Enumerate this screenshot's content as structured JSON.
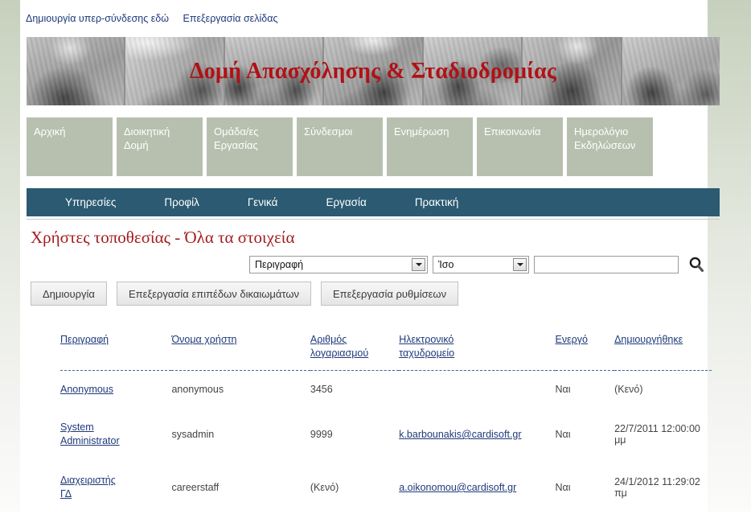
{
  "colors": {
    "brand_red": "#b01116",
    "title_red": "#a41c20",
    "sage": "#b7c0ae",
    "teal": "#2b5a72",
    "link_blue": "#1f3a7a"
  },
  "topbar": {
    "links": [
      {
        "label": "Δημιουργία υπερ-σύνδεσης εδώ"
      },
      {
        "label": "Επεξεργασία σελίδας"
      }
    ]
  },
  "banner": {
    "title": "Δομή Απασχόλησης & Σταδιοδρομίας"
  },
  "mainnav": {
    "items": [
      {
        "line1": "Αρχική",
        "line2": ""
      },
      {
        "line1": "Διοικητική",
        "line2": "Δομή"
      },
      {
        "line1": "Ομάδα/ες",
        "line2": "Εργασίας"
      },
      {
        "line1": "Σύνδεσμοι",
        "line2": ""
      },
      {
        "line1": "Ενημέρωση",
        "line2": ""
      },
      {
        "line1": "Επικοινωνία",
        "line2": ""
      },
      {
        "line1": "Ημερολόγιο",
        "line2": "Εκδηλώσεων"
      }
    ]
  },
  "subnav": {
    "items": [
      {
        "label": "Υπηρεσίες"
      },
      {
        "label": "Προφίλ"
      },
      {
        "label": "Γενικά"
      },
      {
        "label": "Εργασία"
      },
      {
        "label": "Πρακτική"
      }
    ]
  },
  "content": {
    "page_title": "Χρήστες τοποθεσίας - Όλα τα στοιχεία"
  },
  "filter": {
    "field_select": "Περιγραφή",
    "operator_select": "Ίσο",
    "search_value": "",
    "search_placeholder": "",
    "search_icon": "search-icon"
  },
  "buttons": [
    {
      "label": "Δημιουργία"
    },
    {
      "label": "Επεξεργασία επιπέδων δικαιωμάτων"
    },
    {
      "label": "Επεξεργασία ρυθμίσεων"
    }
  ],
  "table": {
    "headers": [
      {
        "line1": "Περιγραφή",
        "line2": ""
      },
      {
        "line1": "Όνομα χρήστη",
        "line2": ""
      },
      {
        "line1": "Αριθμός",
        "line2": "λογαριασμού"
      },
      {
        "line1": "Ηλεκτρονικό",
        "line2": "ταχυδρομείο"
      },
      {
        "line1": "Ενεργό",
        "line2": ""
      },
      {
        "line1": "Δημιουργήθηκε",
        "line2": ""
      }
    ],
    "rows": [
      {
        "description_line1": "Anonymous",
        "description_line2": "",
        "username": "anonymous",
        "account_number": "3456",
        "email": "",
        "active": "Ναι",
        "created": "(Κενό)"
      },
      {
        "description_line1": "System",
        "description_line2": "Administrator",
        "username": "sysadmin",
        "account_number": "9999",
        "email": "k.barbounakis@cardisoft.gr",
        "active": "Ναι",
        "created": "22/7/2011 12:00:00 μμ"
      },
      {
        "description_line1": "Διαχειριστής",
        "description_line2": "ΓΔ",
        "username": "careerstaff",
        "account_number": "(Κενό)",
        "email": "a.oikonomou@cardisoft.gr",
        "active": "Ναι",
        "created": "24/1/2012 11:29:02 πμ"
      }
    ]
  }
}
